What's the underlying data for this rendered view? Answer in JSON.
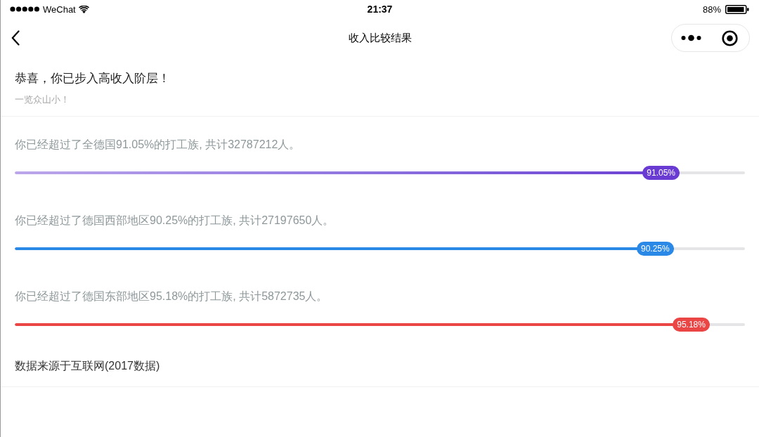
{
  "status_bar": {
    "carrier": "WeChat",
    "time": "21:37",
    "battery": "88%"
  },
  "nav": {
    "title": "收入比较结果"
  },
  "header": {
    "title": "恭喜，你已步入高收入阶层！",
    "subtitle": "一览众山小！"
  },
  "comparisons": [
    {
      "text": "你已经超过了全德国91.05%的打工族, 共计32787212人。",
      "level": 0.9105,
      "badge": "91.05%",
      "color": "#6a3bd2",
      "kind": "gradient"
    },
    {
      "text": "你已经超过了德国西部地区90.25%的打工族, 共计27197650人。",
      "level": 0.9025,
      "badge": "90.25%",
      "color": "#2a88e6",
      "kind": "solid"
    },
    {
      "text": "你已经超过了德国东部地区95.18%的打工族, 共计5872735人。",
      "level": 0.9518,
      "badge": "95.18%",
      "color": "#ea4646",
      "kind": "solid"
    }
  ],
  "source": "数据来源于互联网(2017数据)"
}
